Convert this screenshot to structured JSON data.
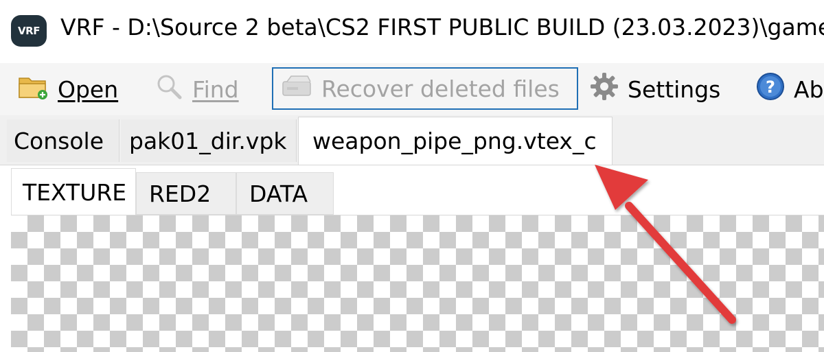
{
  "window": {
    "logo_text": "VRF",
    "title": "VRF - D:\\Source 2 beta\\CS2 FIRST PUBLIC BUILD (23.03.2023)\\game"
  },
  "toolbar": {
    "open_label": "Open",
    "find_label": "Find",
    "recover_label": "Recover deleted files",
    "settings_label": "Settings",
    "about_label": "Ab"
  },
  "tabs": [
    {
      "label": "Console"
    },
    {
      "label": "pak01_dir.vpk"
    },
    {
      "label": "weapon_pipe_png.vtex_c"
    }
  ],
  "subtabs": [
    {
      "label": "TEXTURE"
    },
    {
      "label": "RED2"
    },
    {
      "label": "DATA"
    }
  ],
  "colors": {
    "accent_border": "#1f6fb5",
    "annotation_arrow": "#e23a3a",
    "logo_bg": "#22323c"
  }
}
